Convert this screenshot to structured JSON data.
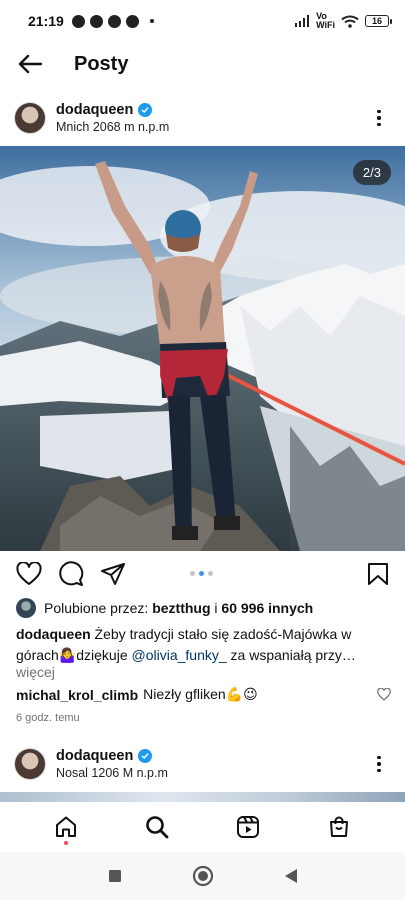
{
  "status_bar": {
    "time": "21:19",
    "network_labels": [
      "Vo",
      "WiFi"
    ],
    "battery": "16"
  },
  "top_bar": {
    "title": "Posty"
  },
  "post": {
    "username": "dodaqueen",
    "location": "Mnich 2068 m n.p.m",
    "carousel_counter": "2/3",
    "carousel_total": 3,
    "carousel_active_index": 2,
    "likes": {
      "prefix": "Polubione przez: ",
      "liker": "beztthug",
      "middle": " i ",
      "count": "60 996 innych"
    },
    "caption": {
      "username": "dodaqueen",
      "text_1": " Żeby tradycji stało się zadość-Majówka w górach🤷‍♀️dziękuje ",
      "mention": "@olivia_funky_",
      "text_2": " za wspaniałą przy…",
      "more": "więcej"
    },
    "comment": {
      "username": "michal_krol_climb",
      "text": "Niezły gfliken💪😉"
    },
    "time_ago": "6 godz. temu"
  },
  "post2": {
    "username": "dodaqueen",
    "location": "Nosal 1206 M n.p.m"
  },
  "colors": {
    "verified": "#1d9bf0",
    "active_dot": "#3897f0",
    "mention": "#00376b",
    "notification_dot": "#ed4956"
  },
  "icons": {
    "back": "arrow-left-icon",
    "more": "three-dots-vertical-icon",
    "like": "heart-icon",
    "comment": "speech-bubble-icon",
    "share": "paper-plane-icon",
    "save": "bookmark-icon",
    "home": "home-icon",
    "search": "search-icon",
    "reels": "reels-icon",
    "shop": "shopping-bag-icon"
  }
}
